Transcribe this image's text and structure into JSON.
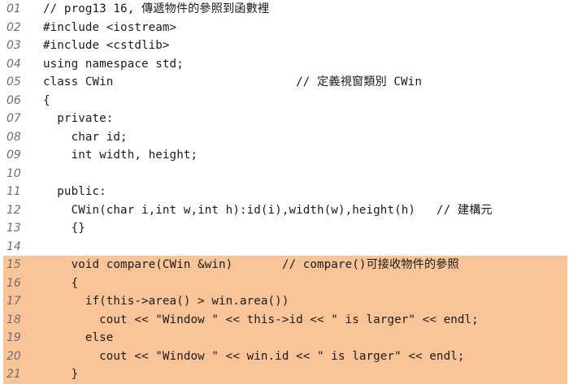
{
  "listing": {
    "lines": [
      {
        "number": "01",
        "code": "// prog13 16, 傳遞物件的參照到函數裡"
      },
      {
        "number": "02",
        "code": "#include <iostream>"
      },
      {
        "number": "03",
        "code": "#include <cstdlib>"
      },
      {
        "number": "04",
        "code": "using namespace std;"
      },
      {
        "number": "05",
        "code": "class CWin                          // 定義視窗類別 CWin"
      },
      {
        "number": "06",
        "code": "{"
      },
      {
        "number": "07",
        "code": "  private:"
      },
      {
        "number": "08",
        "code": "    char id;"
      },
      {
        "number": "09",
        "code": "    int width, height;"
      },
      {
        "number": "10",
        "code": ""
      },
      {
        "number": "11",
        "code": "  public:"
      },
      {
        "number": "12",
        "code": "    CWin(char i,int w,int h):id(i),width(w),height(h)   // 建構元"
      },
      {
        "number": "13",
        "code": "    {}"
      },
      {
        "number": "14",
        "code": ""
      },
      {
        "number": "15",
        "code": "    void compare(CWin &win)       // compare()可接收物件的參照"
      },
      {
        "number": "16",
        "code": "    {"
      },
      {
        "number": "17",
        "code": "      if(this->area() > win.area())"
      },
      {
        "number": "18",
        "code": "        cout << \"Window \" << this->id << \" is larger\" << endl;"
      },
      {
        "number": "19",
        "code": "      else"
      },
      {
        "number": "20",
        "code": "        cout << \"Window \" << win.id << \" is larger\" << endl;"
      },
      {
        "number": "21",
        "code": "    }"
      }
    ]
  },
  "highlight_color": "#f9c598"
}
